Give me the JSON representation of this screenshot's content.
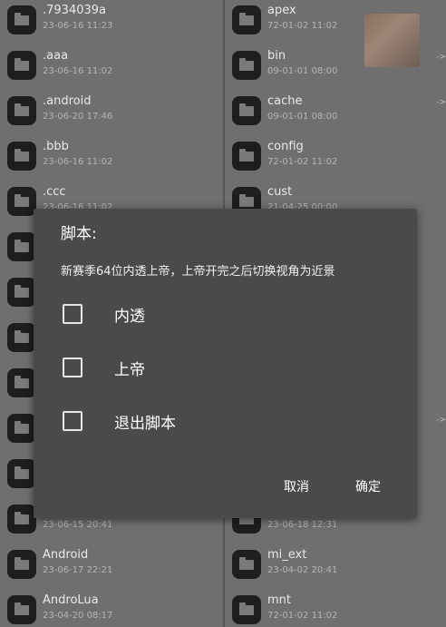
{
  "left_pane": {
    "items": [
      {
        "name": ".7934039a",
        "date": "23-06-16 11:23"
      },
      {
        "name": ".aaa",
        "date": "23-06-16 11:02"
      },
      {
        "name": ".android",
        "date": "23-06-20 17:46"
      },
      {
        "name": ".bbb",
        "date": "23-06-16 11:02"
      },
      {
        "name": ".ccc",
        "date": "23-06-16 11:02"
      },
      {
        "name": "",
        "date": ""
      },
      {
        "name": "",
        "date": ""
      },
      {
        "name": "",
        "date": ""
      },
      {
        "name": "",
        "date": ""
      },
      {
        "name": "",
        "date": ""
      },
      {
        "name": "",
        "date": ""
      },
      {
        "name": "",
        "date": "23-06-15 20:41"
      },
      {
        "name": "Android",
        "date": "23-06-17 22:21"
      },
      {
        "name": "AndroLua",
        "date": "23-04-20 08:17"
      }
    ]
  },
  "right_pane": {
    "items": [
      {
        "name": "apex",
        "date": "72-01-02 11:02"
      },
      {
        "name": "bin",
        "date": "09-01-01 08:00"
      },
      {
        "name": "cache",
        "date": "09-01-01 08:00"
      },
      {
        "name": "config",
        "date": "72-01-02 11:02"
      },
      {
        "name": "cust",
        "date": "21-04-25 00:00"
      },
      {
        "name": "",
        "date": "23-06-18 12:31"
      },
      {
        "name": "mi_ext",
        "date": "23-04-02 20:41"
      },
      {
        "name": "mnt",
        "date": "72-01-02 11:02"
      }
    ],
    "arrows": [
      "->",
      "->",
      "->"
    ]
  },
  "dialog": {
    "title": "脚本:",
    "message": "新赛季64位内透上帝，上帝开完之后切换视角为近景",
    "options": [
      {
        "label": "内透",
        "checked": false
      },
      {
        "label": "上帝",
        "checked": false
      },
      {
        "label": "退出脚本",
        "checked": false
      }
    ],
    "cancel_label": "取消",
    "confirm_label": "确定"
  }
}
